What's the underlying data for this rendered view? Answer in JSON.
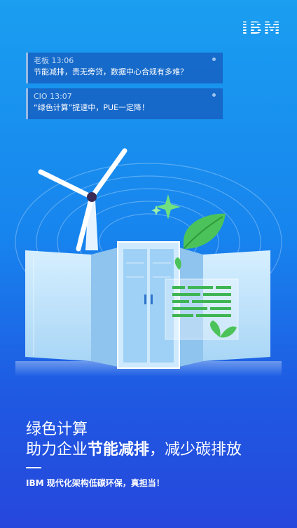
{
  "brand": {
    "logo": "IBM"
  },
  "notifications": [
    {
      "sender": "老板",
      "time": "13:06",
      "message": "节能减排，责无旁贷，数据中心合规有多难？"
    },
    {
      "sender": "CIO",
      "time": "13:07",
      "message": "“绿色计算”提速中，PUE一定降！"
    }
  ],
  "headline": {
    "line1": "绿色计算",
    "line2_prefix": "助力企业",
    "line2_bold": "节能减排",
    "line2_suffix": "，减少碳排放"
  },
  "subline": "IBM 现代化架构低碳环保，真担当！",
  "colors": {
    "bg_top": "#1a9ef0",
    "bg_bottom": "#2647dc",
    "leaf": "#4cc35a",
    "server": "#bfe2fb"
  },
  "icons": [
    "wind-turbine-icon",
    "sparkle-icon",
    "leaf-icon",
    "document-icon",
    "sprout-icon"
  ]
}
